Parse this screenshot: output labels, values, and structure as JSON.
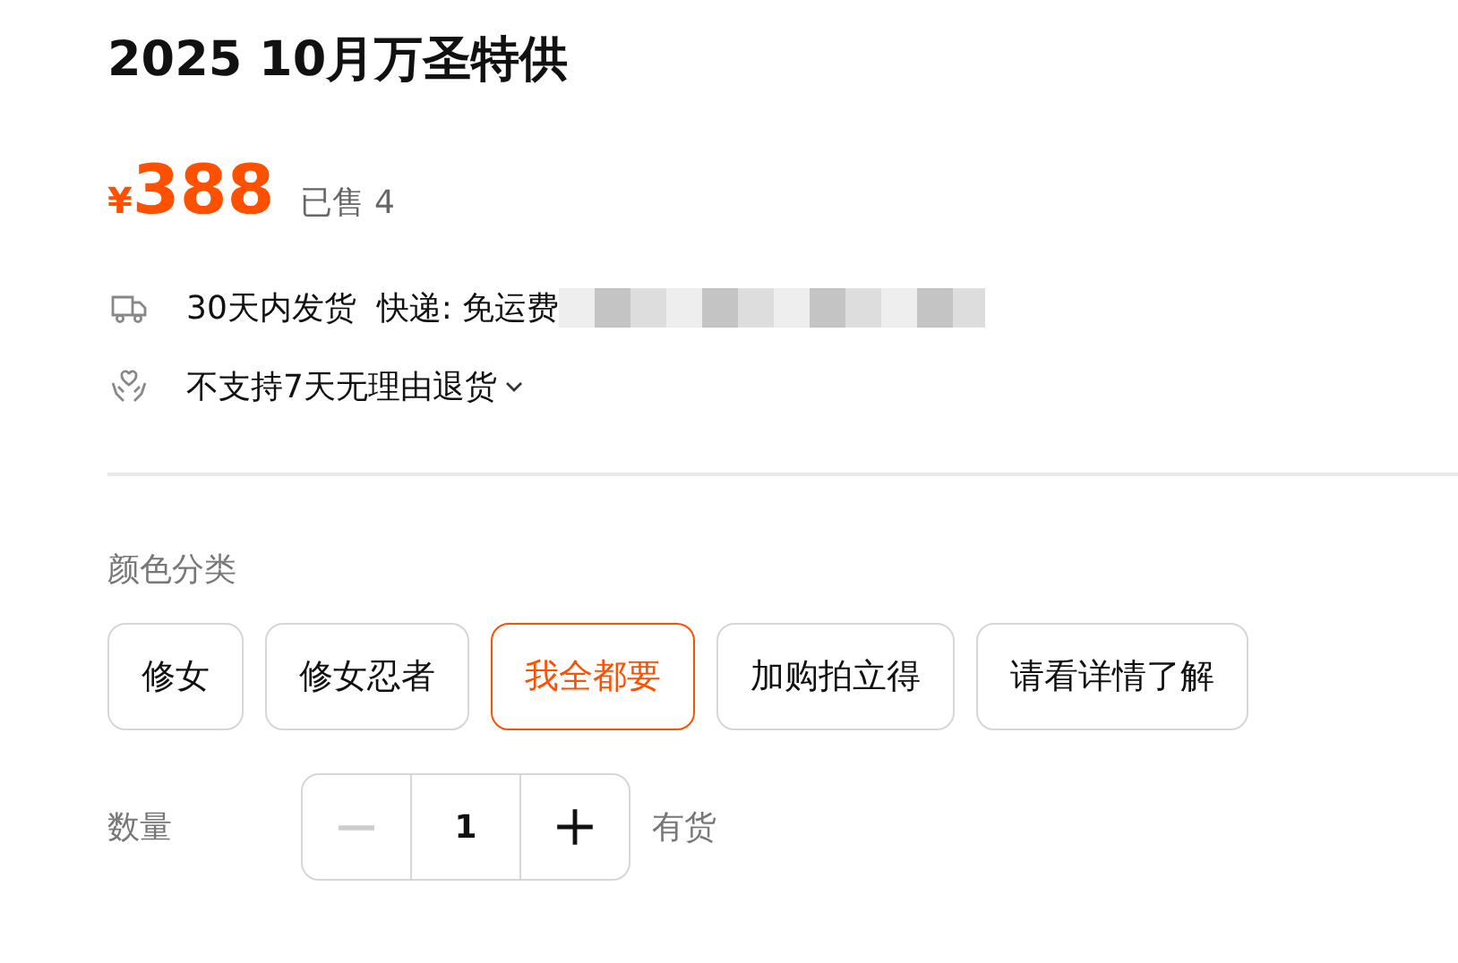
{
  "title": "2025 10月万圣特供",
  "price": {
    "currency": "¥",
    "amount": "388",
    "sold": "已售 4"
  },
  "services": [
    {
      "kind": "delivery",
      "text": "30天内发货  快递: 免运费",
      "blurred": true,
      "has_caret": false
    },
    {
      "kind": "return",
      "text": "不支持7天无理由退货",
      "blurred": false,
      "has_caret": true
    }
  ],
  "options": {
    "label": "颜色分类",
    "items": [
      {
        "label": "修女",
        "selected": false
      },
      {
        "label": "修女忍者",
        "selected": false
      },
      {
        "label": "我全都要",
        "selected": true
      },
      {
        "label": "加购拍立得",
        "selected": false
      },
      {
        "label": "请看详情了解",
        "selected": false
      }
    ]
  },
  "quantity": {
    "label": "数量",
    "minus": {
      "disabled": true
    },
    "value": "1",
    "plus": {
      "disabled": false
    },
    "stock": "有货"
  }
}
